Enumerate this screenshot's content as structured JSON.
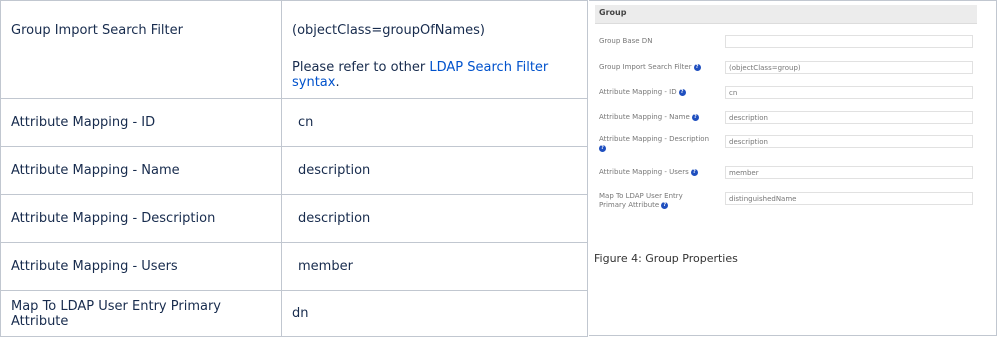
{
  "table": {
    "rows": [
      {
        "key": "Group Import Search Filter",
        "value": "(objectClass=groupOfNames)",
        "note_prefix": "Please refer to other ",
        "note_link": "LDAP Search Filter syntax",
        "note_suffix": "."
      },
      {
        "key": "Attribute Mapping - ID",
        "value": "cn"
      },
      {
        "key": "Attribute Mapping - Name",
        "value": "description"
      },
      {
        "key": "Attribute Mapping - Description",
        "value": "description"
      },
      {
        "key": "Attribute Mapping - Users",
        "value": "member"
      },
      {
        "key": "Map To LDAP User Entry Primary Attribute",
        "value": "dn"
      }
    ]
  },
  "figure": {
    "header": "Group",
    "fields": [
      {
        "label": "Group Base DN",
        "value": ""
      },
      {
        "label": "Group Import Search Filter",
        "value": "(objectClass=group)"
      },
      {
        "label": "Attribute Mapping - ID",
        "value": "cn"
      },
      {
        "label": "Attribute Mapping - Name",
        "value": "description"
      },
      {
        "label": "Attribute Mapping - Description",
        "value": "description"
      },
      {
        "label": "Attribute Mapping - Users",
        "value": "member"
      },
      {
        "label": "Map To LDAP User Entry Primary Attribute",
        "value": "distinguishedName"
      }
    ],
    "help_icon": "?",
    "caption": "Figure 4: Group Properties"
  },
  "colors": {
    "link": "#0052cc",
    "border": "#c1c7d0",
    "help_icon": "#1f4fbf"
  }
}
